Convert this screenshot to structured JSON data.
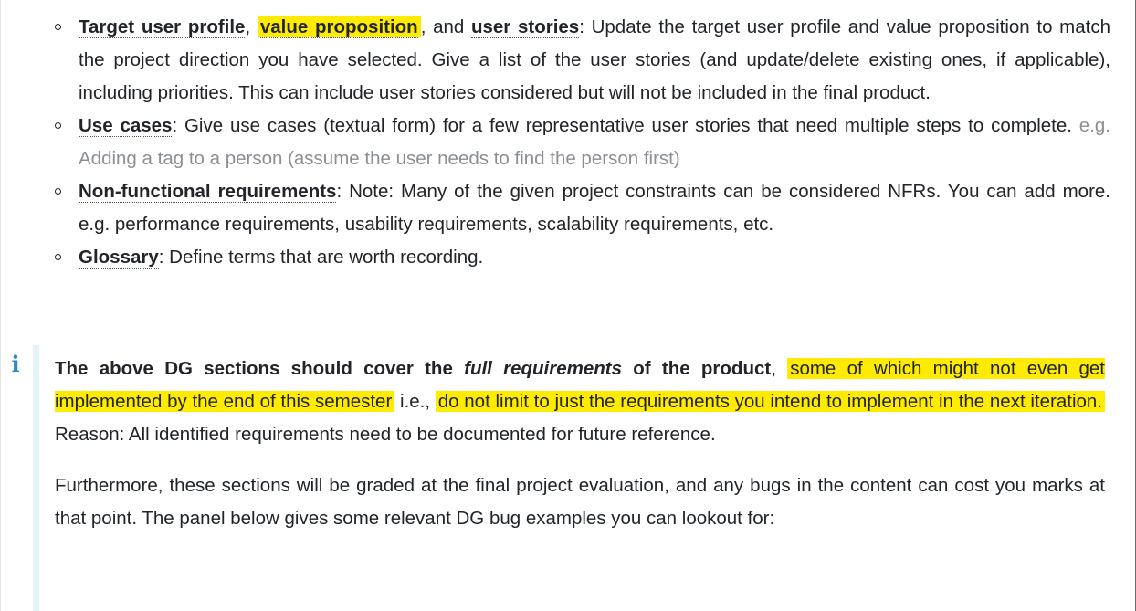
{
  "bullets": [
    {
      "parts": [
        {
          "type": "term",
          "text": "Target user profile"
        },
        {
          "type": "text",
          "text": ", "
        },
        {
          "type": "term-hl",
          "text": "value proposition"
        },
        {
          "type": "text",
          "text": ", and "
        },
        {
          "type": "term",
          "text": "user stories"
        },
        {
          "type": "text",
          "text": ": Update the target user profile and value proposition to match the project direction you have selected. Give a list of the user stories (and update/delete existing ones, if applicable), including priorities. This can include user stories considered but will not be included in the final product."
        }
      ]
    },
    {
      "parts": [
        {
          "type": "term",
          "text": "Use cases"
        },
        {
          "type": "text",
          "text": ": Give use cases (textual form) for a few representative user stories that need multiple steps to complete. "
        },
        {
          "type": "muted",
          "text": "e.g. Adding a tag to a person (assume the user needs to find the person first)"
        }
      ]
    },
    {
      "parts": [
        {
          "type": "term",
          "text": "Non-functional requirements"
        },
        {
          "type": "text",
          "text": ": Note: Many of the given project constraints can be considered NFRs. You can add more. e.g. performance requirements, usability requirements, scalability requirements, etc."
        }
      ]
    },
    {
      "parts": [
        {
          "type": "term",
          "text": "Glossary"
        },
        {
          "type": "text",
          "text": ": Define terms that are worth recording."
        }
      ]
    }
  ],
  "callout": {
    "icon": "i",
    "icon_name": "info-icon",
    "accent_color": "#2a8ec2",
    "bar_color": "#e3f3fb",
    "highlight_color": "#ffeb00",
    "paragraphs": [
      {
        "parts": [
          {
            "type": "bold",
            "text": "The above DG sections should cover the "
          },
          {
            "type": "bold-italic",
            "text": "full requirements"
          },
          {
            "type": "bold",
            "text": " of the product"
          },
          {
            "type": "text",
            "text": ", "
          },
          {
            "type": "hl",
            "text": "some of which might not even get implemented by the end of this semester"
          },
          {
            "type": "text",
            "text": " i.e., "
          },
          {
            "type": "hl",
            "text": "do not limit to just the requirements you intend to implement in the next iteration."
          },
          {
            "type": "text",
            "text": " Reason: All identified requirements need to be documented for future reference."
          }
        ]
      },
      {
        "parts": [
          {
            "type": "text",
            "text": "Furthermore, these sections will be graded at the final project evaluation, and any bugs in the content can cost you marks at that point. The panel below gives some relevant DG bug examples you can lookout for:"
          }
        ]
      }
    ]
  }
}
